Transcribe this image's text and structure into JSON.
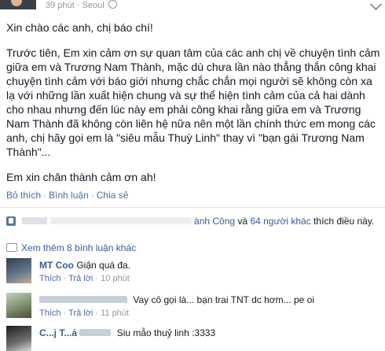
{
  "post": {
    "time": "39 phút",
    "separator": "·",
    "location": "Seoul",
    "paragraphs": [
      "Xin chào các anh, chị báo chí!",
      "Trước tiên, Em xin cảm ơn sự quan tâm của các anh chị về chuyện tình cảm giữa em và Trương Nam Thành, mặc dù chưa lần nào thẳng thắn công khai chuyện tình cảm với báo giới nhưng chắc chắn mọi người sẽ không còn xa lạ với những lần xuất hiện chung và sự thể hiện tình cảm của cả hai dành cho nhau nhưng đến lúc này em phải công khai rằng giữa em và Trương Nam Thành đã không còn liên hệ nữa nên một lần chính thức em mong các anh, chị hãy gọi em là \"siêu mẫu Thuỳ Linh\" thay vì \"bạn gái Trương Nam Thành\"...",
      "Em xin chân thành cảm ơn ah!"
    ],
    "actions": {
      "like": "Bỏ thích",
      "comment": "Bình luận",
      "share": "Chia sẻ",
      "dot": "·"
    }
  },
  "likes": {
    "name_visible": "ành Công",
    "joiner": "và",
    "others_link": "64 người khác",
    "suffix": "thích điều này."
  },
  "comments_section": {
    "view_more": "Xem thêm 8 bình luận khác",
    "comments": [
      {
        "name_partial": "MT Coo",
        "text": "Giận quá đa.",
        "like_label": "Thích",
        "reply_label": "Trả lời",
        "dot": "·",
        "time": "10 phút"
      },
      {
        "name_partial": "",
        "text": "Vay cô gọi là... bạn trai TNT dc hơm... pe oi",
        "like_label": "Thích",
        "reply_label": "Trả lời",
        "dot": "·",
        "time": "11 phút"
      },
      {
        "name_partial": "C...j T...ả",
        "text": "Siu mẫo thuỷ linh :3333"
      }
    ]
  },
  "colors": {
    "link": "#3b5998",
    "action": "#4e69a2",
    "meta": "#9197a3",
    "text": "#141823"
  }
}
